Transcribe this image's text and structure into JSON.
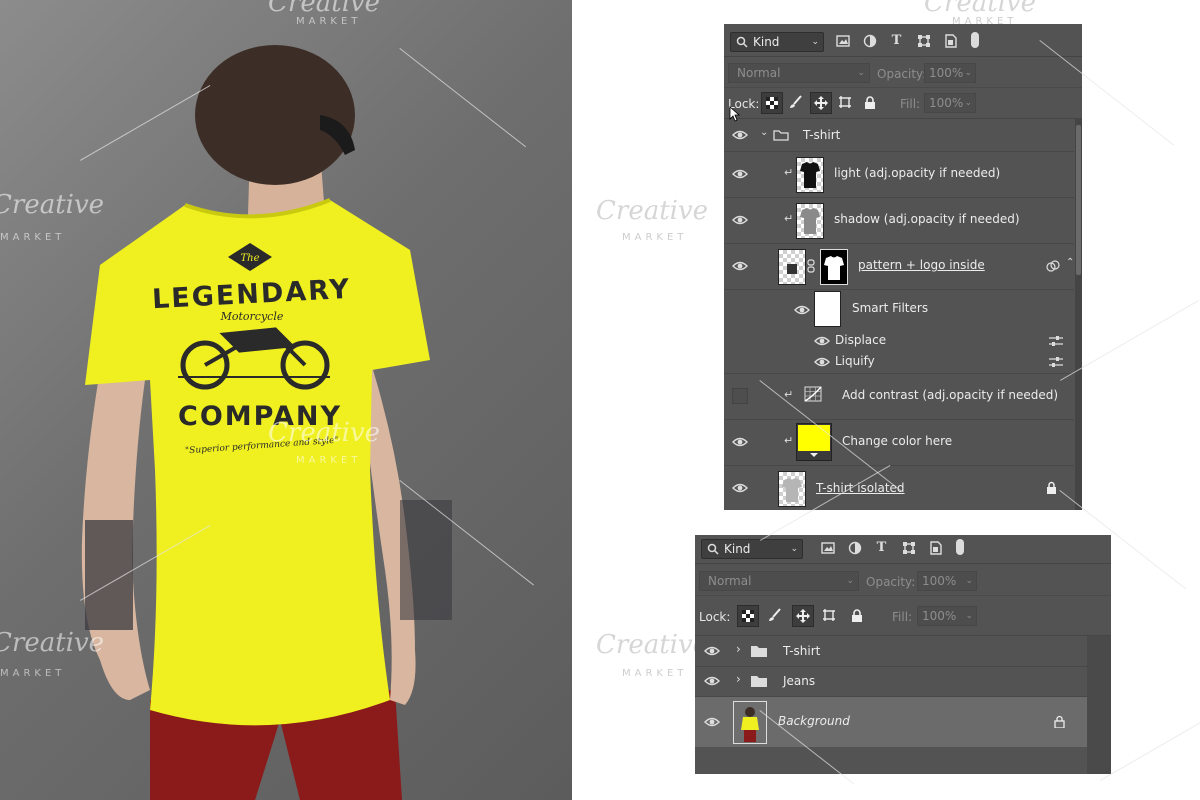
{
  "colors": {
    "shirt": "#f0f020",
    "swatch": "#ffff00",
    "panel_bg": "#535353",
    "pants": "#8b1a1a"
  },
  "photo": {
    "print": {
      "the": "The",
      "legendary": "LEGENDARY",
      "motorcycle": "Motorcycle",
      "company": "COMPANY",
      "tagline": "\"Superior performance and style\""
    }
  },
  "watermark": {
    "brand": "Creative",
    "sub": "MARKET"
  },
  "panel1": {
    "kind_label": "Kind",
    "blend_mode": "Normal",
    "opacity_label": "Opacity:",
    "opacity_value": "100%",
    "lock_label": "Lock:",
    "fill_label": "Fill:",
    "fill_value": "100%",
    "layers": [
      {
        "name": "T-shirt",
        "icon": "folder-icon"
      },
      {
        "name": "light (adj.opacity if needed)"
      },
      {
        "name": "shadow (adj.opacity if needed)"
      },
      {
        "name": "pattern + logo inside"
      },
      {
        "name": "Smart Filters"
      },
      {
        "name": "Displace"
      },
      {
        "name": "Liquify"
      },
      {
        "name": "Add contrast (adj.opacity if needed)"
      },
      {
        "name": "Change color here"
      },
      {
        "name": "T-shirt isolated"
      }
    ]
  },
  "panel2": {
    "kind_label": "Kind",
    "blend_mode": "Normal",
    "opacity_label": "Opacity:",
    "opacity_value": "100%",
    "lock_label": "Lock:",
    "fill_label": "Fill:",
    "fill_value": "100%",
    "layers": [
      {
        "name": "T-shirt",
        "icon": "folder-icon"
      },
      {
        "name": "Jeans",
        "icon": "folder-icon"
      },
      {
        "name": "Background"
      }
    ]
  }
}
